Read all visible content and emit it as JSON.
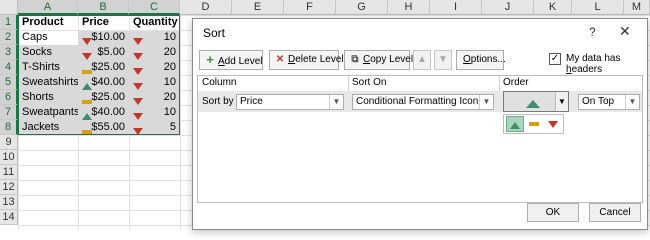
{
  "sheet": {
    "columns": [
      "A",
      "B",
      "C",
      "D",
      "E",
      "F",
      "G",
      "H",
      "I",
      "J",
      "K",
      "L",
      "M"
    ],
    "rows": [
      "1",
      "2",
      "3",
      "4",
      "5",
      "6",
      "7",
      "8",
      "9",
      "10",
      "11",
      "12",
      "13",
      "14"
    ],
    "headers": {
      "product": "Product",
      "price": "Price",
      "quantity": "Quantity"
    },
    "data": [
      {
        "product": "Caps",
        "price_icon": "down",
        "price": "$10.00",
        "qty_icon": "down",
        "qty": "10"
      },
      {
        "product": "Socks",
        "price_icon": "down",
        "price": "$5.00",
        "qty_icon": "down",
        "qty": "20"
      },
      {
        "product": "T-Shirts",
        "price_icon": "flat",
        "price": "$25.00",
        "qty_icon": "down",
        "qty": "20"
      },
      {
        "product": "Sweatshirts",
        "price_icon": "up",
        "price": "$40.00",
        "qty_icon": "down",
        "qty": "10"
      },
      {
        "product": "Shorts",
        "price_icon": "flat",
        "price": "$25.00",
        "qty_icon": "down",
        "qty": "20"
      },
      {
        "product": "Sweatpants",
        "price_icon": "up",
        "price": "$40.00",
        "qty_icon": "down",
        "qty": "10"
      },
      {
        "product": "Jackets",
        "price_icon": "flat",
        "price": "$55.00",
        "qty_icon": "down",
        "qty": "5"
      }
    ]
  },
  "dialog": {
    "title": "Sort",
    "help": "?",
    "close": "✕",
    "toolbar": {
      "add_level_accel": "A",
      "add_level_rest": "dd Level",
      "delete_level_accel": "D",
      "delete_level_rest": "elete Level",
      "copy_level_accel": "C",
      "copy_level_rest": "opy Level",
      "options_accel": "O",
      "options_rest": "ptions...",
      "headers_label_pre": "My data has ",
      "headers_accel": "h",
      "headers_label_post": "eaders",
      "headers_checked": "✓"
    },
    "columns": {
      "column": "Column",
      "sort_on": "Sort On",
      "order": "Order"
    },
    "row": {
      "label": "Sort by",
      "column_value": "Price",
      "sort_on_value": "Conditional Formatting Icon",
      "position_value": "On Top"
    },
    "ok": "OK",
    "cancel": "Cancel",
    "colors": {
      "green": "#3e8e6e",
      "red": "#c0392b",
      "yellow": "#d4a017",
      "accent": "#217346"
    }
  }
}
